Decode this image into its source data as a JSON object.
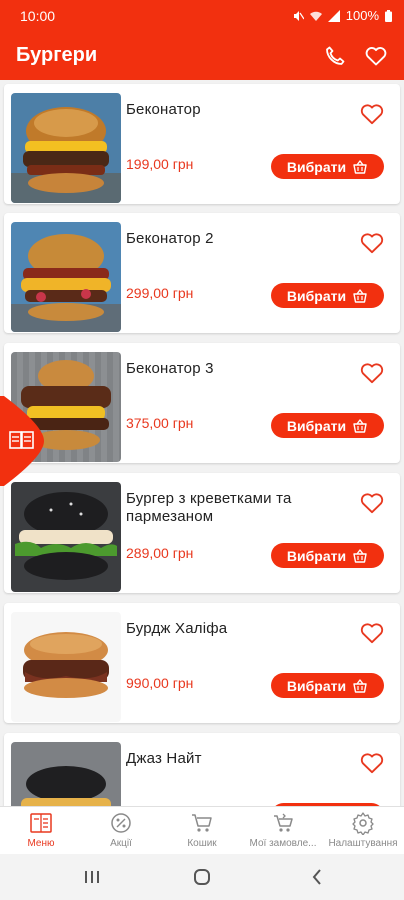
{
  "status_bar": {
    "time": "10:00",
    "battery": "100%"
  },
  "app_bar": {
    "title": "Бургери",
    "phone_icon": "phone-icon",
    "favorites_icon": "heart-icon"
  },
  "colors": {
    "brand": "#f2300f",
    "price": "#e8381f",
    "inactive": "#8a8a8a"
  },
  "products": [
    {
      "name": "Беконатор",
      "price": "199,00 грн",
      "button": "Вибрати"
    },
    {
      "name": "Беконатор 2",
      "price": "299,00 грн",
      "button": "Вибрати"
    },
    {
      "name": "Беконатор 3",
      "price": "375,00 грн",
      "button": "Вибрати"
    },
    {
      "name": "Бургер з креветками та пармезаном",
      "price": "289,00 грн",
      "button": "Вибрати"
    },
    {
      "name": "Бурдж Халіфа",
      "price": "990,00 грн",
      "button": "Вибрати"
    },
    {
      "name": "Джаз Найт",
      "price": "",
      "button": ""
    }
  ],
  "side_tab": {
    "icon": "menu-book-icon"
  },
  "bottom_nav": [
    {
      "label": "Меню",
      "icon": "menu-icon",
      "active": true
    },
    {
      "label": "Акції",
      "icon": "percent-icon",
      "active": false
    },
    {
      "label": "Кошик",
      "icon": "cart-icon",
      "active": false
    },
    {
      "label": "Мої замовле...",
      "icon": "orders-icon",
      "active": false
    },
    {
      "label": "Налаштування",
      "icon": "gear-icon",
      "active": false
    }
  ]
}
